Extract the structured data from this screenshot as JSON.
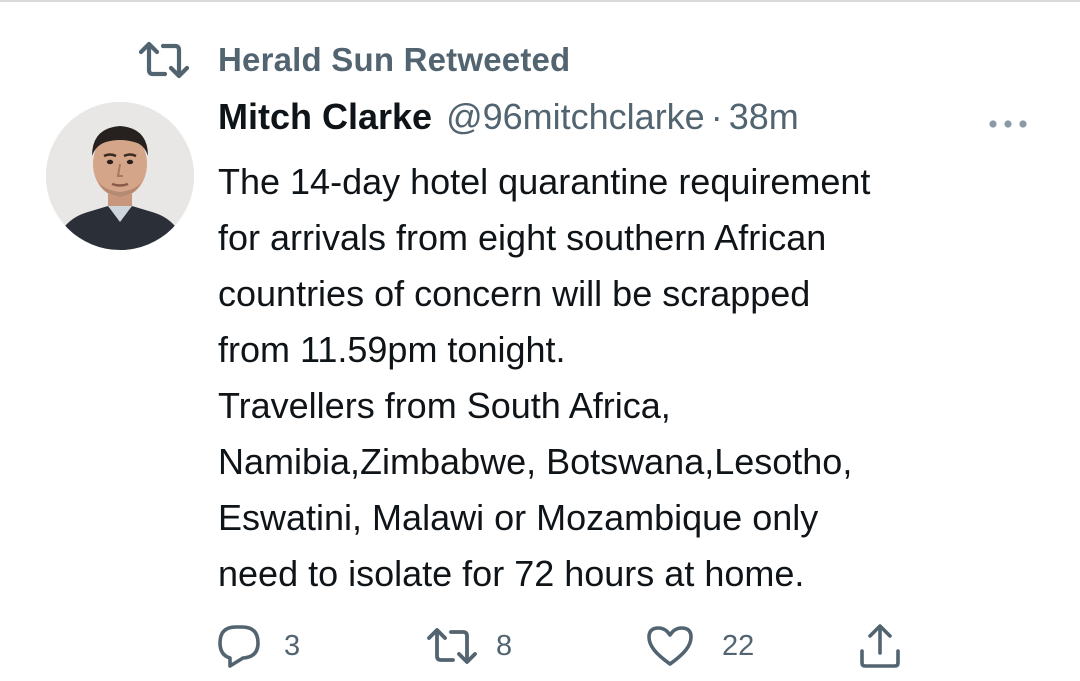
{
  "social_context": {
    "label": "Herald Sun Retweeted",
    "icon": "retweet-icon"
  },
  "author": {
    "name": "Mitch Clarke",
    "handle": "@96mitchclarke",
    "separator": "·",
    "timestamp": "38m"
  },
  "tweet": {
    "lines": [
      "The 14-day hotel quarantine requirement",
      "for arrivals from eight southern African",
      "countries of concern will be scrapped",
      "from 11.59pm tonight.",
      "Travellers from South Africa,",
      "Namibia,Zimbabwe, Botswana,Lesotho,",
      "Eswatini, Malawi or Mozambique only",
      "need to isolate for 72 hours at home."
    ]
  },
  "actions": {
    "reply": {
      "icon": "reply-icon",
      "count": "3"
    },
    "retweet": {
      "icon": "retweet-icon",
      "count": "8"
    },
    "like": {
      "icon": "heart-icon",
      "count": "22"
    },
    "share": {
      "icon": "share-icon"
    }
  },
  "colors": {
    "text_primary": "#0f1419",
    "text_secondary": "#536471",
    "background": "#ffffff"
  }
}
